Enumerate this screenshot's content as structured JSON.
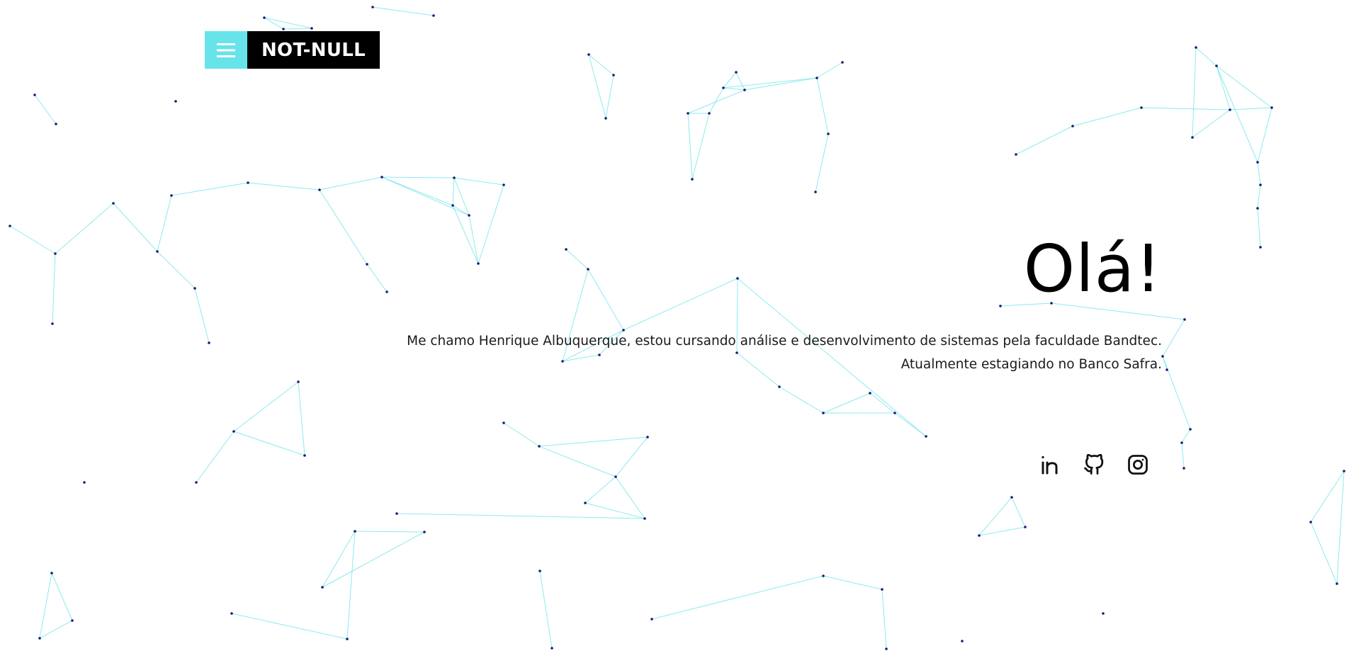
{
  "brand": {
    "menu_icon": "hamburger-menu-icon",
    "name": "NOT-NULL",
    "accent_color": "#67e3ea",
    "logo_background": "#000000"
  },
  "hero": {
    "title": "Olá!",
    "line1": "Me chamo Henrique Albuquerque, estou cursando análise e desenvolvimento de sistemas pela faculdade Bandtec.",
    "line2": "Atualmente estagiando no Banco Safra."
  },
  "socials": [
    {
      "icon": "linkedin-icon"
    },
    {
      "icon": "github-icon"
    },
    {
      "icon": "instagram-icon"
    }
  ],
  "background": {
    "kind": "particle-network",
    "node_color": "#1a1a6e",
    "line_color": "#67e3ea"
  }
}
